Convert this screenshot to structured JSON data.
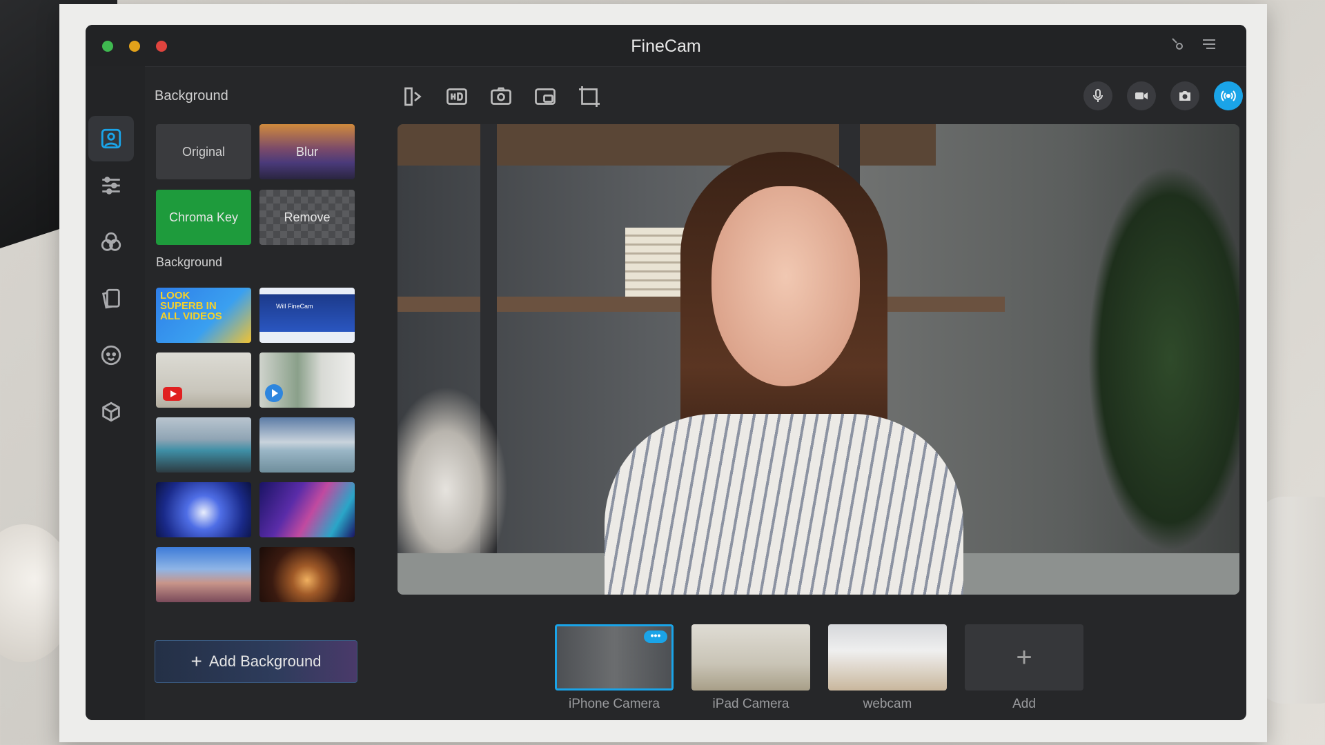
{
  "window": {
    "title": "FineCam"
  },
  "panel": {
    "section_title": "Background",
    "presets": [
      "Original",
      "Blur",
      "Chroma Key",
      "Remove"
    ],
    "library_title": "Background",
    "thumb1_text": "LOOK SUPERB IN ALL VIDEOS",
    "thumb2_text": "Will FineCam",
    "add_button": "Add Background"
  },
  "cameras": [
    {
      "label": "iPhone Camera",
      "selected": true
    },
    {
      "label": "iPad Camera",
      "selected": false
    },
    {
      "label": "webcam",
      "selected": false
    },
    {
      "label": "Add",
      "selected": false
    }
  ],
  "colors": {
    "accent": "#1aa4e8",
    "chroma": "#1e9b3c",
    "background": "#262729"
  },
  "icons": {
    "rail": [
      "portrait-icon",
      "sliders-icon",
      "filters-icon",
      "cards-icon",
      "avatar-icon",
      "3d-cube-icon"
    ],
    "toolbar": [
      "mirror-icon",
      "hd-icon",
      "switch-camera-icon",
      "pip-icon",
      "crop-icon"
    ],
    "controls": [
      "microphone-icon",
      "video-record-icon",
      "snapshot-icon",
      "live-broadcast-icon"
    ]
  }
}
